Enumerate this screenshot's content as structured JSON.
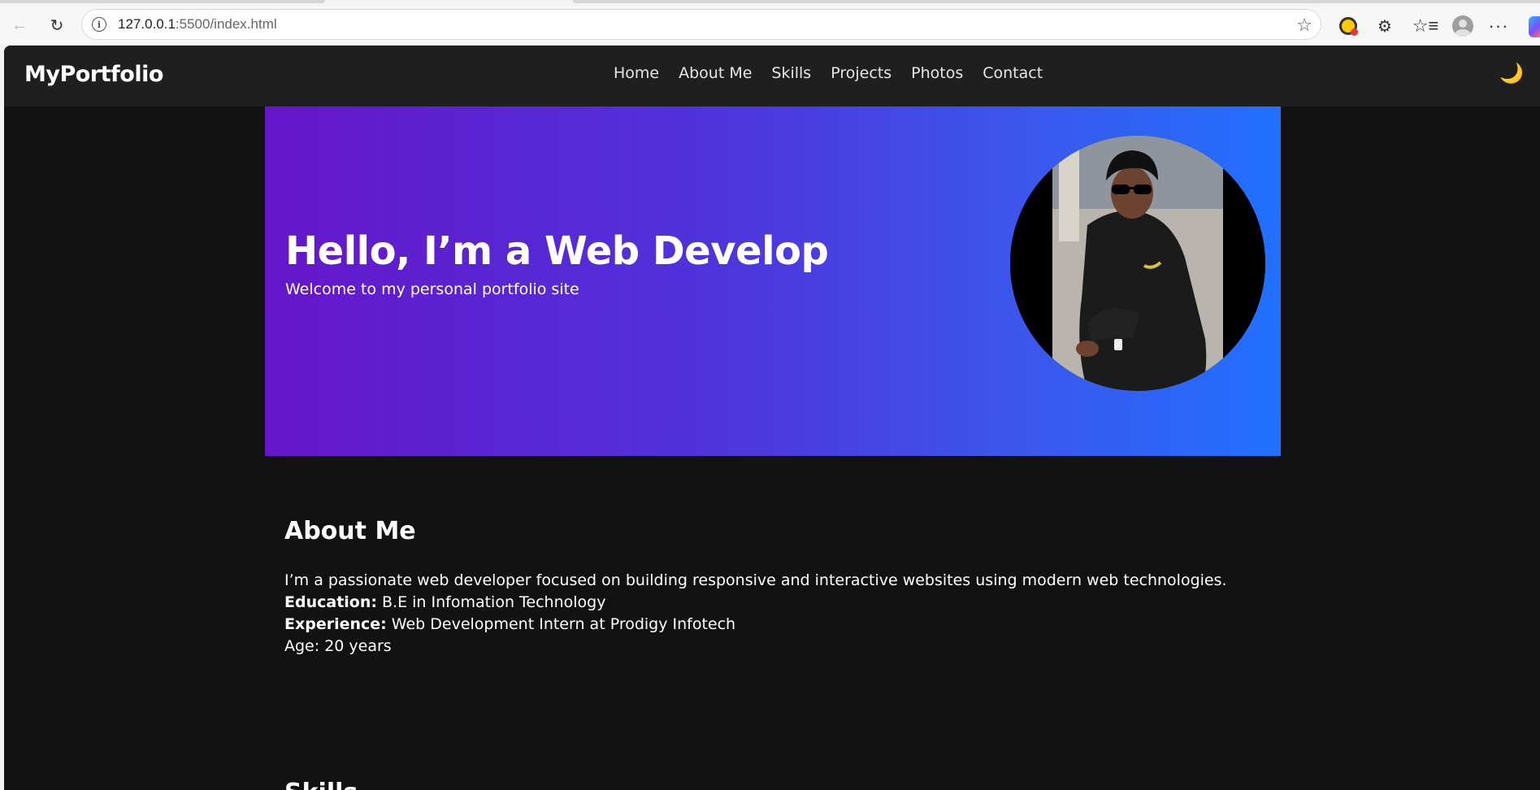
{
  "browser": {
    "url_host": "127.0.0.1",
    "url_path": ":5500/index.html",
    "icons": [
      "back-icon",
      "reload-icon",
      "site-info-icon",
      "star-icon",
      "extension-badge-icon",
      "puzzle-icon",
      "favorites-icon",
      "profile-icon",
      "more-icon",
      "copilot-icon"
    ]
  },
  "nav": {
    "brand": "MyPortfolio",
    "links": [
      "Home",
      "About Me",
      "Skills",
      "Projects",
      "Photos",
      "Contact"
    ],
    "theme_icon": "🌙"
  },
  "hero": {
    "title": "Hello, I’m a Web Develop",
    "subtitle": "Welcome to my personal portfolio site"
  },
  "about": {
    "heading": "About Me",
    "intro": "I’m a passionate web developer focused on building responsive and interactive websites using modern web technologies.",
    "education_label": "Education:",
    "education_value": " B.E in Infomation Technology",
    "experience_label": "Experience:",
    "experience_value": " Web Development Intern at Prodigy Infotech",
    "age": "Age: 20 years"
  },
  "skills": {
    "heading": "Skills"
  },
  "colors": {
    "page_bg": "#121212",
    "nav_bg": "#1f1f1f",
    "hero_gradient_start": "#6516c9",
    "hero_gradient_end": "#2170ff"
  }
}
